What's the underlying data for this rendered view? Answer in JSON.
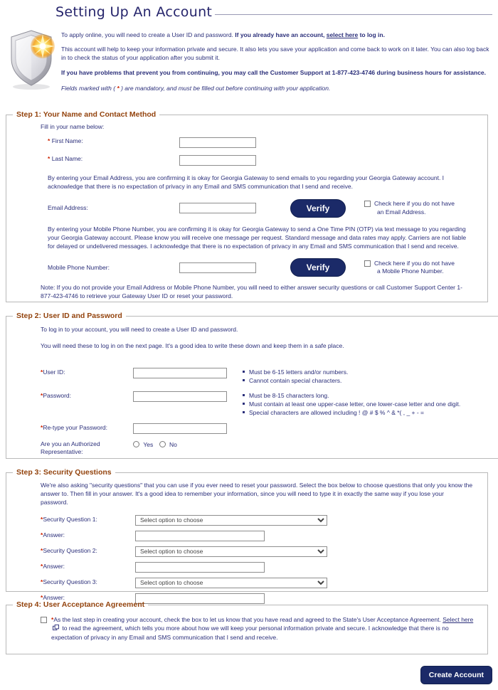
{
  "page": {
    "title": "Setting Up An Account",
    "shield_icon": "shield-with-starburst-icon"
  },
  "intro": {
    "p1_a": "To apply online, you will need to create a User ID and password. ",
    "p1_b": "If you already have an account, ",
    "p1_link": "select here",
    "p1_c": " to log in.",
    "p2": "This account will help to keep your information private and secure. It also lets you save your application and come back to work on it later. You can also log back in to check the status of your application after you submit it.",
    "p3": "If you have problems that prevent you from continuing, you may call the Customer Support at 1-877-423-4746 during business hours for assistance.",
    "p4_a": "Fields marked with ( ",
    "p4_star": "*",
    "p4_b": " ) are mandatory, and must be filled out before continuing with your application."
  },
  "step1": {
    "legend": "Step 1: Your Name and Contact Method",
    "fill_in": "Fill in your name below:",
    "first_name_label": "First Name:",
    "first_name_value": "",
    "last_name_label": "Last Name:",
    "last_name_value": "",
    "email_consent": "By entering your Email Address, you are confirming it is okay for Georgia Gateway to send emails to you regarding your Georgia Gateway account. I acknowledge that there is no expectation of privacy in any Email and SMS communication that I send and receive.",
    "email_label": "Email Address:",
    "email_value": "",
    "email_verify_button": "Verify",
    "email_checkbox_line1": "Check here if you do not have",
    "email_checkbox_line2": "an Email Address.",
    "mobile_consent": "By entering your Mobile Phone Number, you are confirming it is okay for Georgia Gateway to send a One Time PIN (OTP) via text message to you regarding your Georgia Gateway account. Please know you will receive one message per request. Standard message and data rates may apply. Carriers are not liable for delayed or undelivered messages. I acknowledge that there is no expectation of privacy in any Email and SMS communication that I send and receive.",
    "mobile_label": "Mobile Phone Number:",
    "mobile_value": "",
    "mobile_verify_button": "Verify",
    "mobile_checkbox_line1": "Check here if you do not have",
    "mobile_checkbox_line2": "a Mobile Phone Number.",
    "note": "Note: If you do not provide your Email Address or Mobile Phone Number, you will need to either answer security questions or call Customer Support Center 1-877-423-4746 to retrieve your Gateway User ID or reset your password."
  },
  "step2": {
    "legend": "Step 2: User ID and Password",
    "p1": "To log in to your account, you will need to create a User ID and password.",
    "p2": "You will need these to log in on the next page. It's a good idea to write these down and keep them in a safe place.",
    "userid_label": "User ID:",
    "userid_value": "",
    "userid_rules": [
      "Must be 6-15 letters and/or numbers.",
      "Cannot contain special characters."
    ],
    "password_label": "Password:",
    "password_value": "",
    "password_rules": [
      "Must be 8-15 characters long.",
      "Must contain at least one upper-case letter, one lower-case letter and one digit.",
      "Special characters are allowed including ! @ # $ % ^ & *( , _ + - ="
    ],
    "retype_label": "Re-type your Password:",
    "retype_value": "",
    "auth_rep_label_line1": "Are you an Authorized",
    "auth_rep_label_line2": "Representative:",
    "auth_rep_yes": "Yes",
    "auth_rep_no": "No"
  },
  "step3": {
    "legend": "Step 3: Security Questions",
    "p1": "We're also asking \"security questions\" that you can use if you ever need to reset your password. Select the box below to choose questions that only you know the answer to. Then fill in your answer. It's a good idea to remember your information, since you will need to type it in exactly the same way if you lose your password.",
    "select_placeholder": "Select option to choose",
    "rows": [
      {
        "question_label": "Security Question 1:",
        "question_value": "Select option to choose",
        "answer_label": "Answer:",
        "answer_value": ""
      },
      {
        "question_label": "Security Question 2:",
        "question_value": "Select option to choose",
        "answer_label": "Answer:",
        "answer_value": ""
      },
      {
        "question_label": "Security Question 3:",
        "question_value": "Select option to choose",
        "answer_label": "Answer:",
        "answer_value": ""
      }
    ]
  },
  "step4": {
    "legend": "Step 4: User Acceptance Agreement",
    "text_a": "As the last step in creating your account, check the box to let us know that you have read and agreed to the State's User Acceptance Agreement. ",
    "link1": "Select here",
    "text_b": " to read the agreement, which tells you more about how we will keep your personal information private and secure. I acknowledge that there is no expectation of privacy in any Email and SMS communication that I send and receive.",
    "external_link_icon": "open-in-new-window-icon"
  },
  "footer": {
    "create_account_button": "Create Account"
  },
  "colors": {
    "body_text": "#2b2f7a",
    "legend": "#93430d",
    "asterisk": "#cc2200",
    "button": "#1b2a68",
    "title": "#25246b"
  }
}
